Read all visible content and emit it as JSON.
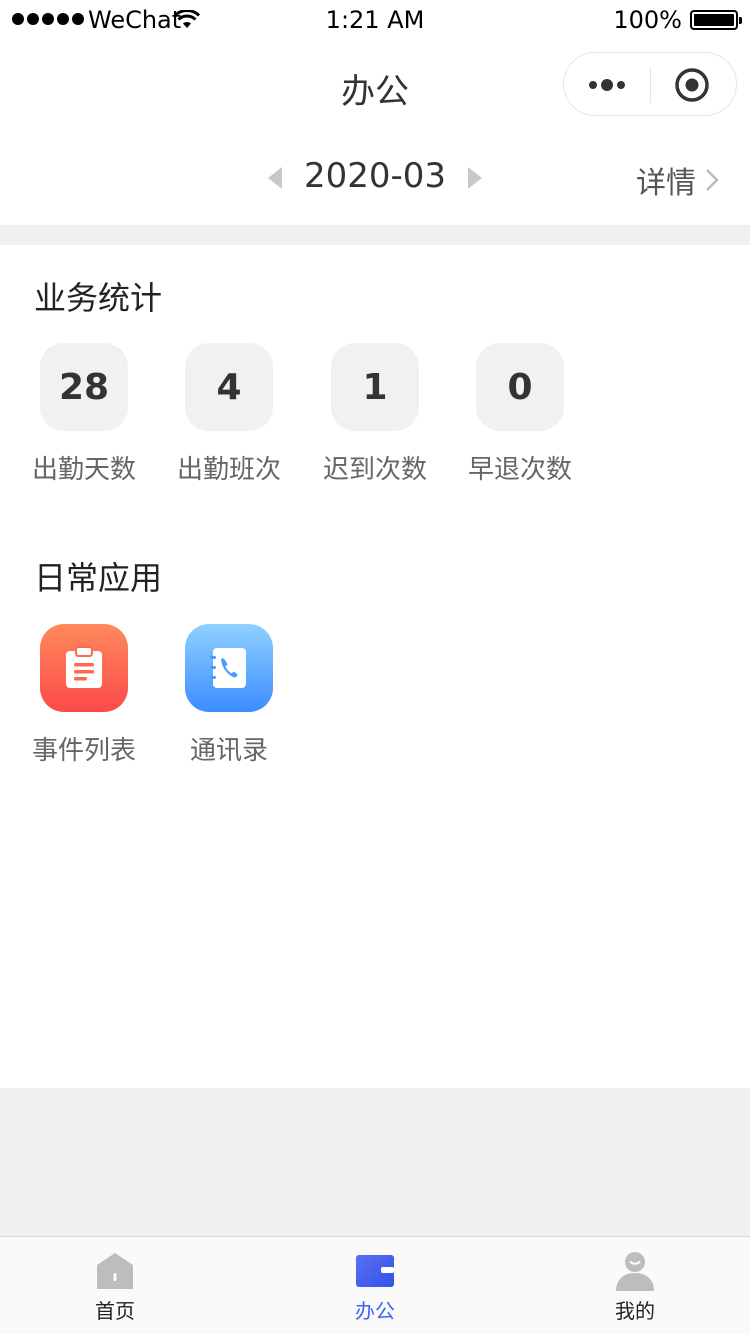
{
  "status_bar": {
    "carrier": "WeChat",
    "time": "1:21 AM",
    "battery": "100%"
  },
  "nav": {
    "title": "办公"
  },
  "month_selector": {
    "value": "2020-03",
    "details_label": "详情"
  },
  "stats": {
    "title": "业务统计",
    "items": [
      {
        "value": "28",
        "label": "出勤天数"
      },
      {
        "value": "4",
        "label": "出勤班次"
      },
      {
        "value": "1",
        "label": "迟到次数"
      },
      {
        "value": "0",
        "label": "早退次数"
      }
    ]
  },
  "apps": {
    "title": "日常应用",
    "items": [
      {
        "label": "事件列表",
        "icon": "clipboard-icon",
        "color": "#fb5a4f"
      },
      {
        "label": "通讯录",
        "icon": "address-book-icon",
        "color": "#4c9bff"
      }
    ]
  },
  "tab_bar": {
    "active_color": "#3f63f0",
    "items": [
      {
        "label": "首页",
        "icon": "home-icon"
      },
      {
        "label": "办公",
        "icon": "briefcase-icon"
      },
      {
        "label": "我的",
        "icon": "user-icon"
      }
    ]
  }
}
